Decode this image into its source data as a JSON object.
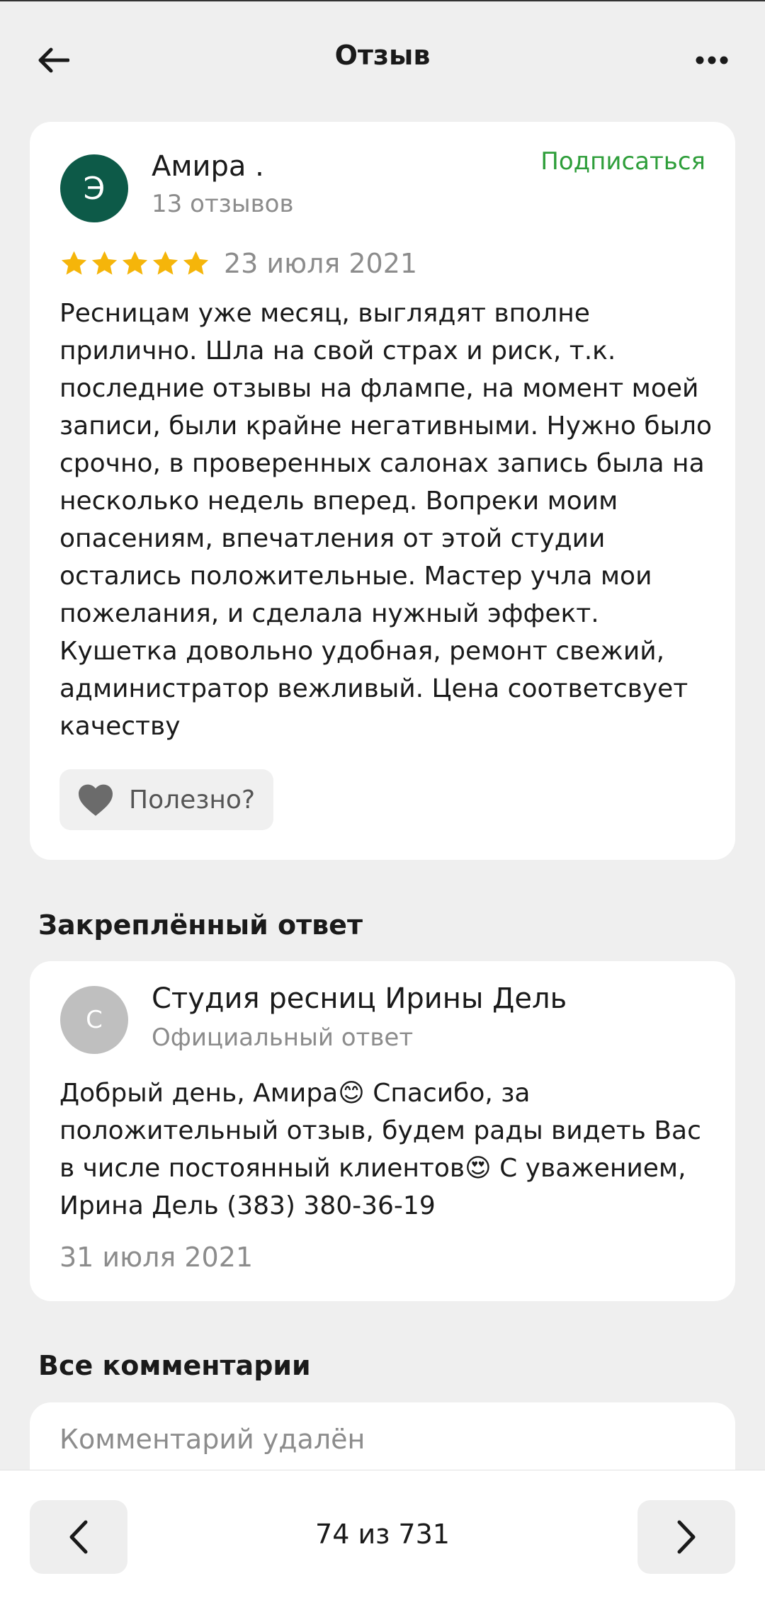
{
  "header": {
    "title": "Отзыв",
    "back_icon": "arrow-left-icon",
    "more_icon": "more-dots-icon"
  },
  "review": {
    "avatar_letter": "Э",
    "author": "Амира .",
    "reviews_count": "13 отзывов",
    "subscribe_label": "Подписаться",
    "rating": 5,
    "rating_max": 5,
    "date": "23 июля 2021",
    "text": "Ресницам уже месяц, выглядят вполне прилично. Шла на свой страх и риск, т.к. последние отзывы на флампе, на момент моей записи, были крайне негативными. Нужно было срочно, в проверенных салонах запись была на несколько недель вперед. Вопреки моим опасениям, впечатления от этой студии остались положительные. Мастер учла мои пожелания, и сделала нужный эффект. Кушетка довольно удобная, ремонт свежий, администратор вежливый. Цена соответсвует качеству",
    "useful_label": "Полезно?"
  },
  "pinned": {
    "section_title": "Закреплённый ответ",
    "avatar_letter": "С",
    "name": "Студия ресниц Ирины Дель",
    "subtitle": "Официальный ответ",
    "text": "Добрый день, Амира😊 Спасибо, за положительный отзыв, будем рады видеть Вас в числе постоянный клиентов😍 С уважением, Ирина Дель (383) 380-36-19",
    "date": "31 июля 2021"
  },
  "comments": {
    "section_title": "Все комментарии",
    "first_comment": "Комментарий удалён"
  },
  "pager": {
    "text": "74 из 731"
  },
  "colors": {
    "accent_green": "#2e9e3a",
    "avatar_dark_green": "#0d5a48",
    "star_yellow": "#f5b50a"
  }
}
